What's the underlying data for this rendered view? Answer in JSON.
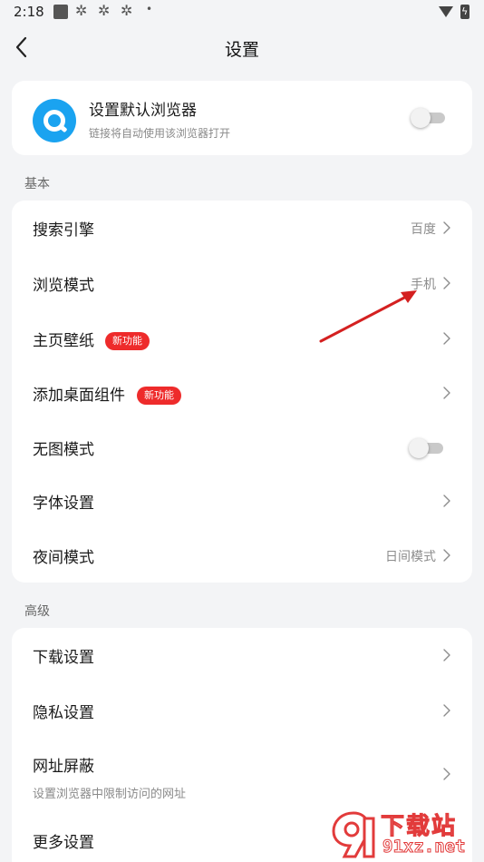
{
  "status_bar": {
    "time": "2:18",
    "notification_icons": [
      "square-notification-icon",
      "pinwheel-icon",
      "pinwheel-icon",
      "pinwheel-icon"
    ],
    "more_dot": "•"
  },
  "header": {
    "title": "设置",
    "back_icon": "chevron-left-icon"
  },
  "default_browser": {
    "title": "设置默认浏览器",
    "subtitle": "链接将自动使用该浏览器打开",
    "toggle_on": false
  },
  "sections": [
    {
      "label": "基本",
      "rows": [
        {
          "label": "搜索引擎",
          "value": "百度"
        },
        {
          "label": "浏览模式",
          "value": "手机"
        },
        {
          "label": "主页壁纸",
          "badge": "新功能"
        },
        {
          "label": "添加桌面组件",
          "badge": "新功能"
        },
        {
          "label": "无图模式",
          "toggle_on": false
        },
        {
          "label": "字体设置"
        },
        {
          "label": "夜间模式",
          "value": "日间模式"
        }
      ]
    },
    {
      "label": "高级",
      "rows": [
        {
          "label": "下载设置"
        },
        {
          "label": "隐私设置"
        },
        {
          "label": "网址屏蔽",
          "subtitle": "设置浏览器中限制访问的网址"
        },
        {
          "label": "更多设置"
        }
      ]
    }
  ],
  "watermark": {
    "top_text": "下载站",
    "bottom_text": "91xz.net"
  },
  "colors": {
    "page_bg": "#f3f4f6",
    "card_bg": "#ffffff",
    "badge_red": "#ee2b2b",
    "logo_blue": "#1aa3f0",
    "annotation_arrow": "#d42020"
  }
}
